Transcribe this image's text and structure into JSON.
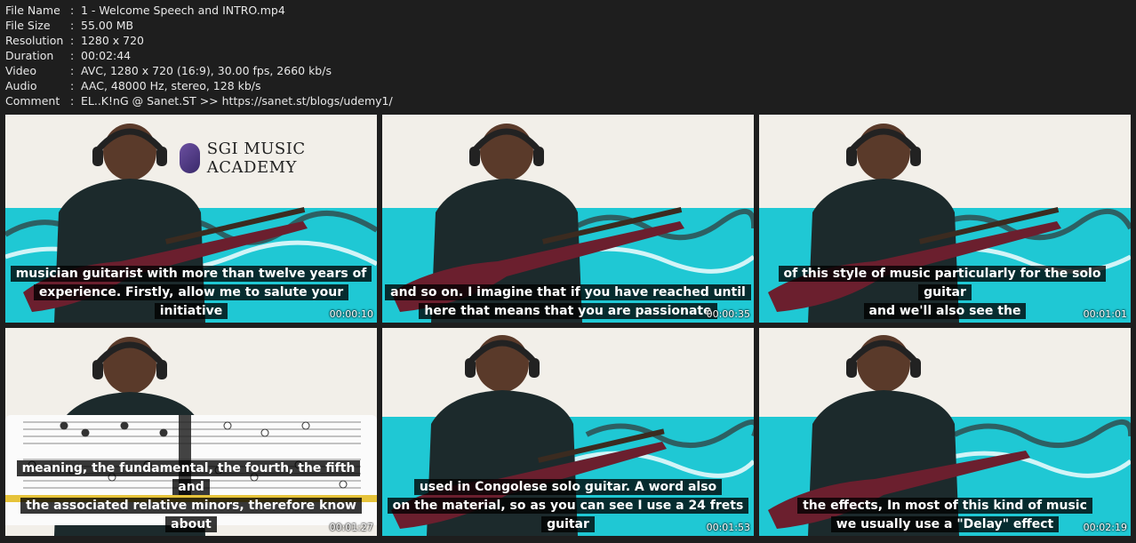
{
  "metadata": [
    {
      "key": "File Name",
      "value": "1 - Welcome Speech and INTRO.mp4"
    },
    {
      "key": "File Size",
      "value": "55.00 MB"
    },
    {
      "key": "Resolution",
      "value": "1280 x 720"
    },
    {
      "key": "Duration",
      "value": "00:02:44"
    },
    {
      "key": "Video",
      "value": "AVC, 1280 x 720 (16:9), 30.00 fps, 2660 kb/s"
    },
    {
      "key": "Audio",
      "value": "AAC, 48000 Hz, stereo, 128 kb/s"
    },
    {
      "key": "Comment",
      "value": "EL..K!nG @ Sanet.ST >> https://sanet.st/blogs/udemy1/"
    }
  ],
  "separator": ":",
  "logo_text": "SGI MUSIC ACADEMY",
  "thumbnails": [
    {
      "line1": "musician guitarist with more than twelve years of",
      "line2": "experience. Firstly,  allow me to salute your initiative",
      "time": "00:00:10"
    },
    {
      "line1": "and so on. I imagine that if you have reached until",
      "line2": "here that means that you are passionate",
      "time": "00:00:35"
    },
    {
      "line1": "of this style of music particularly for the solo guitar",
      "line2": "and we'll also see the",
      "time": "00:01:01"
    },
    {
      "line1": "meaning, the fundamental, the fourth, the fifth and",
      "line2": "the associated relative minors, therefore know about",
      "time": "00:01:27"
    },
    {
      "line1": "used in Congolese solo guitar. A word also",
      "line2": "on the material, so as you can see I use a 24 frets guitar",
      "time": "00:01:53"
    },
    {
      "line1": "the effects, In most of this kind of music",
      "line2": "we usually use a \"Delay\" effect",
      "time": "00:02:19"
    }
  ],
  "colors": {
    "background": "#1e1e1e",
    "sofa": "#1fc8d4",
    "shirt": "#1c2a2c",
    "guitar": "#6b1f2e",
    "wall": "#f2efe9"
  }
}
